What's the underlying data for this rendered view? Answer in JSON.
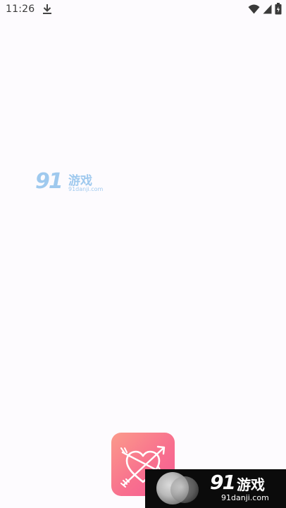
{
  "status_bar": {
    "time": "11:26",
    "icons": [
      "download-icon",
      "wifi-icon",
      "signal-icon",
      "battery-icon"
    ]
  },
  "watermark_top": {
    "number": "91",
    "chinese": "游戏",
    "domain": "91danji.com",
    "color": "#9fc9ee"
  },
  "app_icon": {
    "icon": "heart-arrow-icon",
    "gradient": [
      "#fb9b8b",
      "#f8708e",
      "#f55a95"
    ]
  },
  "watermark_bottom": {
    "number": "91",
    "chinese": "游戏",
    "domain": "91danji.com",
    "background": "#0b0b0b"
  },
  "background": "#fdfbfe"
}
